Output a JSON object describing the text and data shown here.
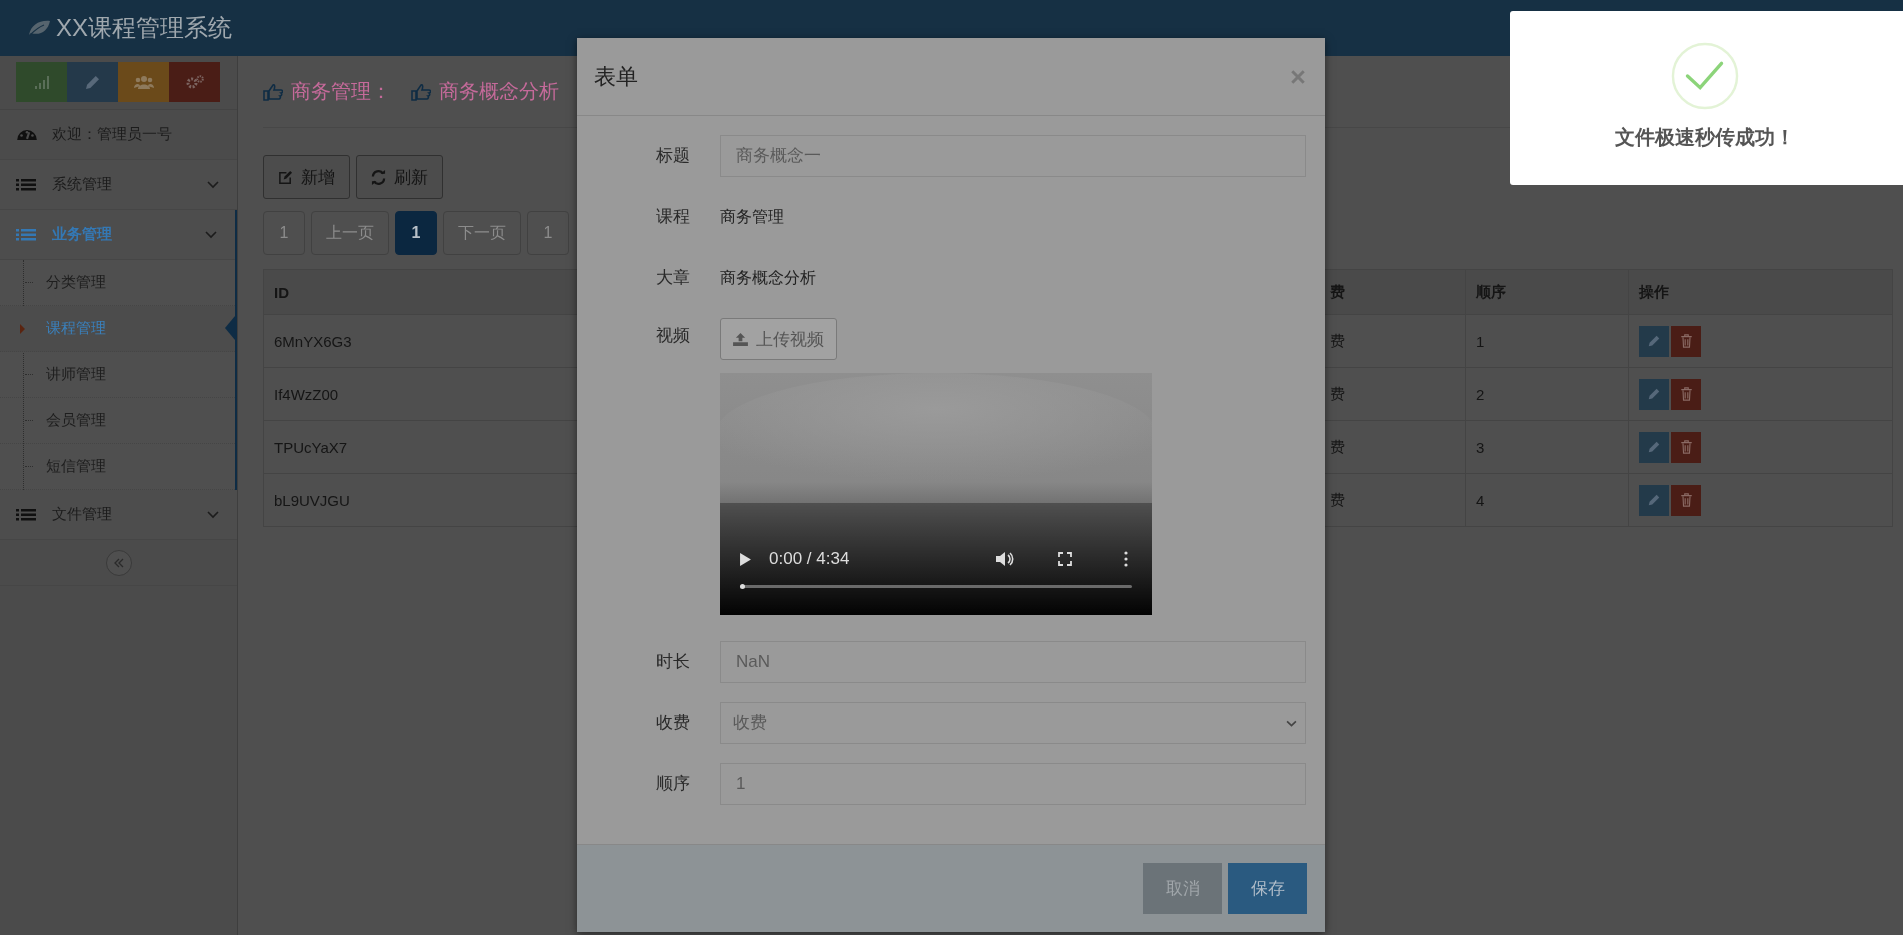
{
  "header": {
    "title": "XX课程管理系统"
  },
  "sidebar": {
    "shortcuts": [
      {
        "kind": "stats",
        "color": "#2f4a2b"
      },
      {
        "kind": "edit",
        "color": "#24394a"
      },
      {
        "kind": "users",
        "color": "#6b4a1a"
      },
      {
        "kind": "settings",
        "color": "#4a1d16"
      }
    ],
    "welcome": "欢迎：管理员一号",
    "menu": [
      {
        "label": "系统管理",
        "selected": false
      },
      {
        "label": "业务管理",
        "selected": true,
        "children": [
          {
            "label": "分类管理",
            "selected": false
          },
          {
            "label": "课程管理",
            "selected": true
          },
          {
            "label": "讲师管理",
            "selected": false
          },
          {
            "label": "会员管理",
            "selected": false
          },
          {
            "label": "短信管理",
            "selected": false
          }
        ]
      },
      {
        "label": "文件管理",
        "selected": false
      }
    ]
  },
  "breadcrumb": [
    "商务管理：",
    "商务概念分析"
  ],
  "toolbar": [
    {
      "label": "新增",
      "kind": "add"
    },
    {
      "label": "刷新",
      "kind": "refresh"
    }
  ],
  "pagination": [
    {
      "label": "1",
      "selected": false,
      "disabled": true
    },
    {
      "label": "上一页",
      "selected": false,
      "disabled": true
    },
    {
      "label": "1",
      "selected": true,
      "disabled": false
    },
    {
      "label": "下一页",
      "selected": false,
      "disabled": true
    },
    {
      "label": "1",
      "selected": false,
      "disabled": true
    }
  ],
  "table": {
    "columns": [
      "ID",
      "费",
      "顺序",
      "操作"
    ],
    "rows": [
      {
        "id": "6MnYX6G3",
        "fee": "费",
        "order": "1"
      },
      {
        "id": "If4WzZ00",
        "fee": "费",
        "order": "2"
      },
      {
        "id": "TPUcYaX7",
        "fee": "费",
        "order": "3"
      },
      {
        "id": "bL9UVJGU",
        "fee": "费",
        "order": "4"
      }
    ]
  },
  "modal": {
    "title": "表单",
    "fields": [
      {
        "label": "标题",
        "kind": "input",
        "value": "商务概念一"
      },
      {
        "label": "课程",
        "kind": "text",
        "value": "商务管理"
      },
      {
        "label": "大章",
        "kind": "text",
        "value": "商务概念分析"
      },
      {
        "label": "视频",
        "kind": "upload",
        "button": "上传视频",
        "time": "0:00 / 4:34",
        "level": 0
      },
      {
        "label": "时长",
        "kind": "input",
        "value": "NaN"
      },
      {
        "label": "收费",
        "kind": "select",
        "value": "收费"
      },
      {
        "label": "顺序",
        "kind": "input",
        "value": "1"
      }
    ],
    "buttons": [
      {
        "label": "取消",
        "kind": "secondary"
      },
      {
        "label": "保存",
        "kind": "primary"
      }
    ]
  },
  "toast": {
    "message": "文件极速秒传成功！"
  }
}
